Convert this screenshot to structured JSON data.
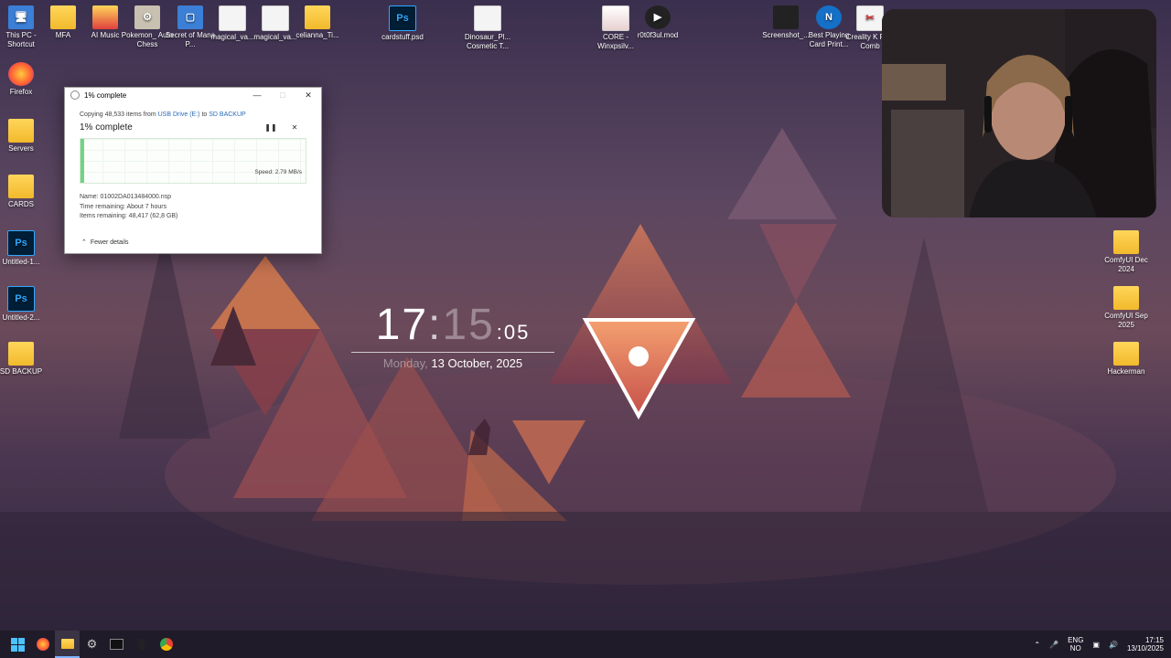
{
  "desktop_icons_left": [
    {
      "label": "This PC - Shortcut",
      "kind": "app",
      "glyph": "🖥"
    },
    {
      "label": "Firefox",
      "kind": "app",
      "glyph": "🦊"
    },
    {
      "label": "Servers",
      "kind": "folder",
      "glyph": ""
    },
    {
      "label": "CARDS",
      "kind": "folder",
      "glyph": ""
    },
    {
      "label": "Untitled-1...",
      "kind": "ps",
      "glyph": "Ps"
    },
    {
      "label": "Untitled-2...",
      "kind": "ps",
      "glyph": "Ps"
    },
    {
      "label": "SD BACKUP",
      "kind": "folder",
      "glyph": ""
    }
  ],
  "desktop_icons_top": [
    {
      "label": "MFA",
      "kind": "folder",
      "glyph": ""
    },
    {
      "label": "AI Music",
      "kind": "folder",
      "glyph": ""
    },
    {
      "label": "Pokemon_ Auto Chess",
      "kind": "app",
      "glyph": "⚙"
    },
    {
      "label": "Secret of Mana P...",
      "kind": "app",
      "glyph": "▢"
    },
    {
      "label": "magical_va...",
      "kind": "file",
      "glyph": ""
    },
    {
      "label": "magical_va...",
      "kind": "file",
      "glyph": ""
    },
    {
      "label": "celianna_Ti...",
      "kind": "folder",
      "glyph": ""
    },
    {
      "label": "cardstuff.psd",
      "kind": "ps",
      "glyph": "Ps"
    },
    {
      "label": "Dinosaur_Pl... Cosmetic T...",
      "kind": "file",
      "glyph": ""
    },
    {
      "label": "CORE - Winxpsilv...",
      "kind": "file",
      "glyph": ""
    },
    {
      "label": "r0t0f3ul.mod",
      "kind": "dark",
      "glyph": "▶"
    },
    {
      "label": "Screenshot_...",
      "kind": "dark",
      "glyph": ""
    },
    {
      "label": "Best Playing Card Print...",
      "kind": "app",
      "glyph": "N"
    },
    {
      "label": "Creality K Plus Comb",
      "kind": "file",
      "glyph": "✂"
    }
  ],
  "desktop_icons_right": [
    {
      "label": "ComfyUI Dec 2024",
      "kind": "folder",
      "glyph": ""
    },
    {
      "label": "ComfyUI Sep 2025",
      "kind": "folder",
      "glyph": ""
    },
    {
      "label": "Hackerman",
      "kind": "folder",
      "glyph": ""
    }
  ],
  "dialog": {
    "title": "1% complete",
    "copying_prefix": "Copying 48,533 items from ",
    "source": "USB Drive (E:)",
    "to_word": " to ",
    "destination": "SD BACKUP",
    "percent_label": "1% complete",
    "progress_fraction": 0.01,
    "speed": "Speed: 2.79 MB/s",
    "name_line": "Name: 01002DA013484000.nsp",
    "time_remaining": "Time remaining: About 7 hours",
    "items_remaining": "Items remaining: 48,417 (62,8 GB)",
    "fewer_details": "Fewer details"
  },
  "clock": {
    "hours": "17",
    "colon": ":",
    "minutes": "15",
    "seconds": ":05",
    "weekday": "Monday,",
    "date": "13 October, 2025"
  },
  "taskbar": {
    "lang_top": "ENG",
    "lang_bottom": "NO",
    "time": "17:15",
    "date": "13/10/2025"
  }
}
